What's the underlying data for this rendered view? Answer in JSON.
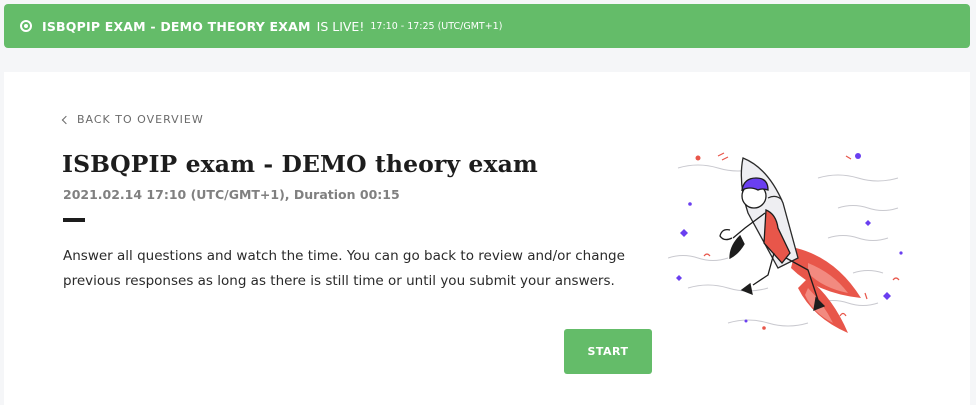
{
  "banner": {
    "title": "ISBQPIP EXAM - DEMO THEORY EXAM",
    "live_text": "IS LIVE!",
    "time": "17:10 - 17:25 (UTC/GMT+1)",
    "color": "#64bc69"
  },
  "exam": {
    "back_label": "BACK TO OVERVIEW",
    "title": "ISBQPIP exam - DEMO theory exam",
    "schedule": "2021.02.14 17:10 (UTC/GMT+1), Duration 00:15",
    "description": "Answer all questions and watch the time. You can go back to review and/or change previous responses as long as there is still time or until you submit your answers.",
    "start_label": "START"
  },
  "icons": {
    "live": "live-radio-icon",
    "back": "chevron-left-icon",
    "illustration": "rocket-person-illustration"
  },
  "colors": {
    "accent": "#64bc69",
    "text_dark": "#1d1d1d",
    "text_muted": "#808080",
    "illustration_red": "#e8564a",
    "illustration_purple": "#6a3ff0"
  }
}
